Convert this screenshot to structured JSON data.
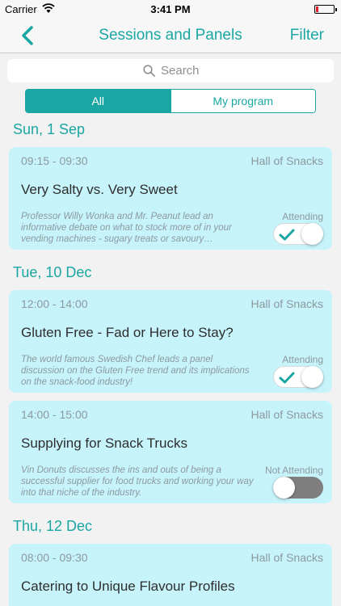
{
  "status_bar": {
    "carrier": "Carrier",
    "time": "3:41 PM"
  },
  "nav": {
    "title": "Sessions and Panels",
    "filter_label": "Filter"
  },
  "search": {
    "placeholder": "Search"
  },
  "segment": {
    "all_label": "All",
    "my_program_label": "My program",
    "selected": "All"
  },
  "colors": {
    "accent": "#1aa7a3",
    "card": "#c7f3fb"
  },
  "days": [
    {
      "date": "Sun, 1 Sep",
      "sessions": [
        {
          "time": "09:15 - 09:30",
          "venue": "Hall of Snacks",
          "title": "Very Salty vs. Very Sweet",
          "description": "Professor Willy Wonka and Mr. Peanut lead an informative debate on what to stock more of in your vending machines - sugary treats or savoury…",
          "status": "Attending",
          "attending": true
        }
      ]
    },
    {
      "date": "Tue, 10 Dec",
      "sessions": [
        {
          "time": "12:00 - 14:00",
          "venue": "Hall of Snacks",
          "title": "Gluten Free - Fad or Here to Stay?",
          "description": "The world famous Swedish Chef leads a panel discussion on the Gluten Free trend and its implications on the snack-food industry!",
          "status": "Attending",
          "attending": true
        },
        {
          "time": "14:00 - 15:00",
          "venue": "Hall of Snacks",
          "title": "Supplying for Snack Trucks",
          "description": "Vin Donuts discusses the ins and outs of being a successful supplier for food trucks and working your way into that niche of the industry.",
          "status": "Not Attending",
          "attending": false
        }
      ]
    },
    {
      "date": "Thu, 12 Dec",
      "sessions": [
        {
          "time": "08:00 - 09:30",
          "venue": "Hall of Snacks",
          "title": "Catering to Unique Flavour Profiles"
        }
      ]
    }
  ]
}
